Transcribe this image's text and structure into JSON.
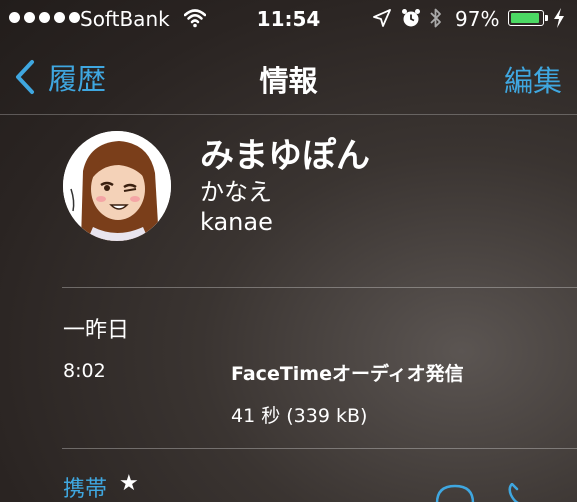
{
  "status_bar": {
    "carrier": "SoftBank",
    "time": "11:54",
    "battery_percent": "97%",
    "battery_level": 0.97,
    "icons": [
      "signal-dots",
      "wifi-icon",
      "location-arrow-icon",
      "alarm-icon",
      "bluetooth-icon",
      "battery-icon",
      "charging-bolt-icon"
    ]
  },
  "nav": {
    "back_label": "履歴",
    "title": "情報",
    "edit_label": "編集"
  },
  "contact": {
    "name": "みまゆぽん",
    "reading": "かなえ",
    "company": "kanae"
  },
  "history": {
    "date": "一昨日",
    "time": "8:02",
    "call_type": "FaceTimeオーディオ発信",
    "duration": "41 秒 (339 kB)"
  },
  "phone": {
    "label": "携帯",
    "star": "★"
  },
  "colors": {
    "accent": "#3fa7e0",
    "battery": "#4cd964"
  }
}
